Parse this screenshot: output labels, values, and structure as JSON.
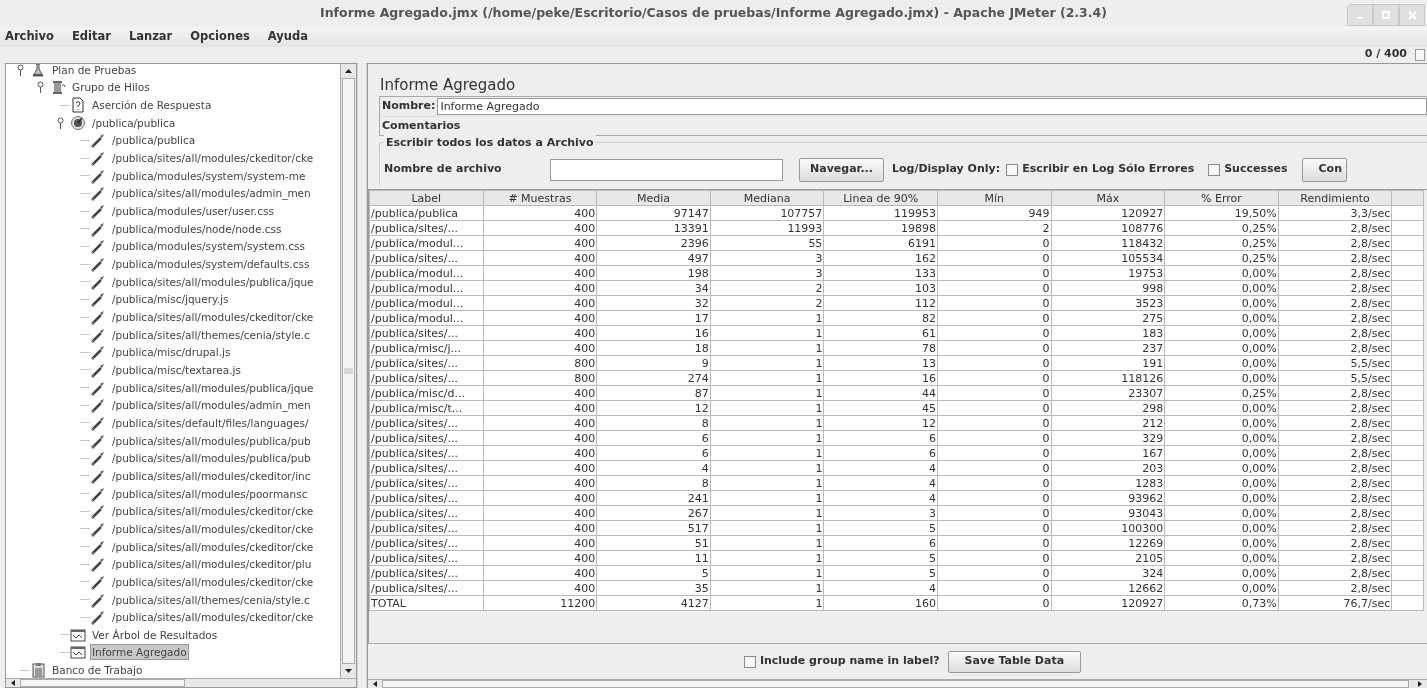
{
  "window": {
    "title": "Informe Agregado.jmx (/home/peke/Escritorio/Casos de pruebas/Informe Agregado.jmx) - Apache JMeter (2.3.4)"
  },
  "menu": [
    "Archivo",
    "Editar",
    "Lanzar",
    "Opciones",
    "Ayuda"
  ],
  "progress": "0 / 400",
  "tree": [
    {
      "label": "Plan de Pruebas",
      "kind": "plan",
      "expanded": true,
      "selected": false,
      "children": [
        {
          "label": "Grupo de Hilos",
          "kind": "thread_group",
          "expanded": true,
          "selected": false,
          "children": [
            {
              "label": "Aserción de Respuesta",
              "kind": "assertion",
              "selected": false
            },
            {
              "label": "/publica/publica",
              "kind": "controller",
              "expanded": true,
              "selected": false,
              "children": [
                {
                  "label": "/publica/publica",
                  "kind": "sampler",
                  "selected": false
                },
                {
                  "label": "/publica/sites/all/modules/ckeditor/cke",
                  "kind": "sampler",
                  "selected": false
                },
                {
                  "label": "/publica/modules/system/system-me",
                  "kind": "sampler",
                  "selected": false
                },
                {
                  "label": "/publica/sites/all/modules/admin_men",
                  "kind": "sampler",
                  "selected": false
                },
                {
                  "label": "/publica/modules/user/user.css",
                  "kind": "sampler",
                  "selected": false
                },
                {
                  "label": "/publica/modules/node/node.css",
                  "kind": "sampler",
                  "selected": false
                },
                {
                  "label": "/publica/modules/system/system.css",
                  "kind": "sampler",
                  "selected": false
                },
                {
                  "label": "/publica/modules/system/defaults.css",
                  "kind": "sampler",
                  "selected": false
                },
                {
                  "label": "/publica/sites/all/modules/publica/jque",
                  "kind": "sampler",
                  "selected": false
                },
                {
                  "label": "/publica/misc/jquery.js",
                  "kind": "sampler",
                  "selected": false
                },
                {
                  "label": "/publica/sites/all/modules/ckeditor/cke",
                  "kind": "sampler",
                  "selected": false
                },
                {
                  "label": "/publica/sites/all/themes/cenia/style.c",
                  "kind": "sampler",
                  "selected": false
                },
                {
                  "label": "/publica/misc/drupal.js",
                  "kind": "sampler",
                  "selected": false
                },
                {
                  "label": "/publica/misc/textarea.js",
                  "kind": "sampler",
                  "selected": false
                },
                {
                  "label": "/publica/sites/all/modules/publica/jque",
                  "kind": "sampler",
                  "selected": false
                },
                {
                  "label": "/publica/sites/all/modules/admin_men",
                  "kind": "sampler",
                  "selected": false
                },
                {
                  "label": "/publica/sites/default/files/languages/",
                  "kind": "sampler",
                  "selected": false
                },
                {
                  "label": "/publica/sites/all/modules/publica/pub",
                  "kind": "sampler",
                  "selected": false
                },
                {
                  "label": "/publica/sites/all/modules/publica/pub",
                  "kind": "sampler",
                  "selected": false
                },
                {
                  "label": "/publica/sites/all/modules/ckeditor/inc",
                  "kind": "sampler",
                  "selected": false
                },
                {
                  "label": "/publica/sites/all/modules/poormansc",
                  "kind": "sampler",
                  "selected": false
                },
                {
                  "label": "/publica/sites/all/modules/ckeditor/cke",
                  "kind": "sampler",
                  "selected": false
                },
                {
                  "label": "/publica/sites/all/modules/ckeditor/cke",
                  "kind": "sampler",
                  "selected": false
                },
                {
                  "label": "/publica/sites/all/modules/ckeditor/cke",
                  "kind": "sampler",
                  "selected": false
                },
                {
                  "label": "/publica/sites/all/modules/ckeditor/plu",
                  "kind": "sampler",
                  "selected": false
                },
                {
                  "label": "/publica/sites/all/modules/ckeditor/cke",
                  "kind": "sampler",
                  "selected": false
                },
                {
                  "label": "/publica/sites/all/themes/cenia/style.c",
                  "kind": "sampler",
                  "selected": false
                },
                {
                  "label": "/publica/sites/all/modules/ckeditor/cke",
                  "kind": "sampler",
                  "selected": false
                }
              ]
            },
            {
              "label": "Ver Árbol de Resultados",
              "kind": "listener",
              "selected": false
            },
            {
              "label": "Informe Agregado",
              "kind": "listener",
              "selected": true
            }
          ]
        }
      ]
    },
    {
      "label": "Banco de Trabajo",
      "kind": "workbench",
      "selected": false
    }
  ],
  "panel": {
    "title": "Informe Agregado",
    "name_label": "Nombre:",
    "name_value": "Informe Agregado",
    "comments_label": "Comentarios",
    "file_group": {
      "legend": "Escribir todos los datos a Archivo",
      "filename_label": "Nombre de archivo",
      "browse_button": "Navegar...",
      "log_label": "Log/Display Only:",
      "checkboxes": [
        {
          "label": "Escribir en Log Sólo Errores",
          "checked": false
        },
        {
          "label": "Successes",
          "checked": false
        }
      ],
      "config_button": "Con"
    }
  },
  "table": {
    "columns": [
      "Label",
      "# Muestras",
      "Media",
      "Mediana",
      "Linea de 90%",
      "Mín",
      "Máx",
      "% Error",
      "Rendimiento"
    ],
    "rows": [
      [
        "/publica/publica",
        "400",
        "97147",
        "107757",
        "119953",
        "949",
        "120927",
        "19,50%",
        "3,3/sec"
      ],
      [
        "/publica/sites/...",
        "400",
        "13391",
        "11993",
        "19898",
        "2",
        "108776",
        "0,25%",
        "2,8/sec"
      ],
      [
        "/publica/modul...",
        "400",
        "2396",
        "55",
        "6191",
        "0",
        "118432",
        "0,25%",
        "2,8/sec"
      ],
      [
        "/publica/sites/...",
        "400",
        "497",
        "3",
        "162",
        "0",
        "105534",
        "0,25%",
        "2,8/sec"
      ],
      [
        "/publica/modul...",
        "400",
        "198",
        "3",
        "133",
        "0",
        "19753",
        "0,00%",
        "2,8/sec"
      ],
      [
        "/publica/modul...",
        "400",
        "34",
        "2",
        "103",
        "0",
        "998",
        "0,00%",
        "2,8/sec"
      ],
      [
        "/publica/modul...",
        "400",
        "32",
        "2",
        "112",
        "0",
        "3523",
        "0,00%",
        "2,8/sec"
      ],
      [
        "/publica/modul...",
        "400",
        "17",
        "1",
        "82",
        "0",
        "275",
        "0,00%",
        "2,8/sec"
      ],
      [
        "/publica/sites/...",
        "400",
        "16",
        "1",
        "61",
        "0",
        "183",
        "0,00%",
        "2,8/sec"
      ],
      [
        "/publica/misc/j...",
        "400",
        "18",
        "1",
        "78",
        "0",
        "237",
        "0,00%",
        "2,8/sec"
      ],
      [
        "/publica/sites/...",
        "800",
        "9",
        "1",
        "13",
        "0",
        "191",
        "0,00%",
        "5,5/sec"
      ],
      [
        "/publica/sites/...",
        "800",
        "274",
        "1",
        "16",
        "0",
        "118126",
        "0,00%",
        "5,5/sec"
      ],
      [
        "/publica/misc/d...",
        "400",
        "87",
        "1",
        "44",
        "0",
        "23307",
        "0,25%",
        "2,8/sec"
      ],
      [
        "/publica/misc/t...",
        "400",
        "12",
        "1",
        "45",
        "0",
        "298",
        "0,00%",
        "2,8/sec"
      ],
      [
        "/publica/sites/...",
        "400",
        "8",
        "1",
        "12",
        "0",
        "212",
        "0,00%",
        "2,8/sec"
      ],
      [
        "/publica/sites/...",
        "400",
        "6",
        "1",
        "6",
        "0",
        "329",
        "0,00%",
        "2,8/sec"
      ],
      [
        "/publica/sites/...",
        "400",
        "6",
        "1",
        "6",
        "0",
        "167",
        "0,00%",
        "2,8/sec"
      ],
      [
        "/publica/sites/...",
        "400",
        "4",
        "1",
        "4",
        "0",
        "203",
        "0,00%",
        "2,8/sec"
      ],
      [
        "/publica/sites/...",
        "400",
        "8",
        "1",
        "4",
        "0",
        "1283",
        "0,00%",
        "2,8/sec"
      ],
      [
        "/publica/sites/...",
        "400",
        "241",
        "1",
        "4",
        "0",
        "93962",
        "0,00%",
        "2,8/sec"
      ],
      [
        "/publica/sites/...",
        "400",
        "267",
        "1",
        "3",
        "0",
        "93043",
        "0,00%",
        "2,8/sec"
      ],
      [
        "/publica/sites/...",
        "400",
        "517",
        "1",
        "5",
        "0",
        "100300",
        "0,00%",
        "2,8/sec"
      ],
      [
        "/publica/sites/...",
        "400",
        "51",
        "1",
        "6",
        "0",
        "12269",
        "0,00%",
        "2,8/sec"
      ],
      [
        "/publica/sites/...",
        "400",
        "11",
        "1",
        "5",
        "0",
        "2105",
        "0,00%",
        "2,8/sec"
      ],
      [
        "/publica/sites/...",
        "400",
        "5",
        "1",
        "5",
        "0",
        "324",
        "0,00%",
        "2,8/sec"
      ],
      [
        "/publica/sites/...",
        "400",
        "35",
        "1",
        "4",
        "0",
        "12662",
        "0,00%",
        "2,8/sec"
      ],
      [
        "TOTAL",
        "11200",
        "4127",
        "1",
        "160",
        "0",
        "120927",
        "0,73%",
        "76,7/sec"
      ]
    ]
  },
  "footer": {
    "checkbox": {
      "label": "Include group name in label?",
      "checked": false
    },
    "save_button": "Save Table Data"
  }
}
